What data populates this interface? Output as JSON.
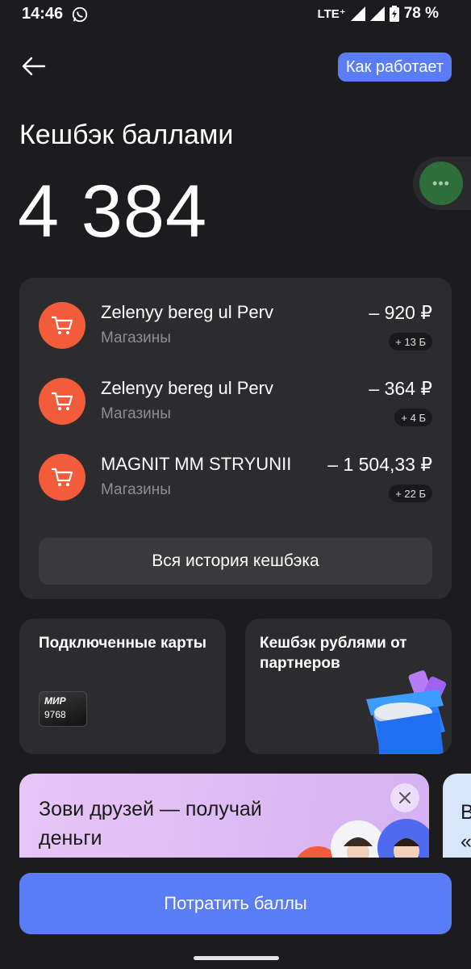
{
  "status_bar": {
    "time": "14:46",
    "network": "LTE⁺",
    "battery": "78 %"
  },
  "header": {
    "how_it_works": "Как работает"
  },
  "title": "Кешбэк баллами",
  "balance": "4 384",
  "transactions": [
    {
      "name": "Zelenyy bereg ul Perv",
      "category": "Магазины",
      "amount": "– 920 ₽",
      "points": "+ 13 Б"
    },
    {
      "name": "Zelenyy bereg ul Perv",
      "category": "Магазины",
      "amount": "– 364 ₽",
      "points": "+ 4 Б"
    },
    {
      "name": "MAGNIT MM STRYUNII",
      "category": "Магазины",
      "amount": "– 1 504,33 ₽",
      "points": "+ 22 Б"
    }
  ],
  "history_button": "Вся история кешбэка",
  "cards_block": {
    "title": "Подключенные карты",
    "card_brand": "МИР",
    "card_number": "9768"
  },
  "partners_block": {
    "title": "Кешбэк рублями от партнеров"
  },
  "promo": {
    "text": "Зови друзей — получай деньги",
    "next_partial": "В\n«"
  },
  "spend_button": "Потратить баллы",
  "colors": {
    "background": "#1c1c1e",
    "card": "#2c2c2e",
    "accent": "#5b7cf7",
    "shop_icon": "#f25c3b"
  }
}
